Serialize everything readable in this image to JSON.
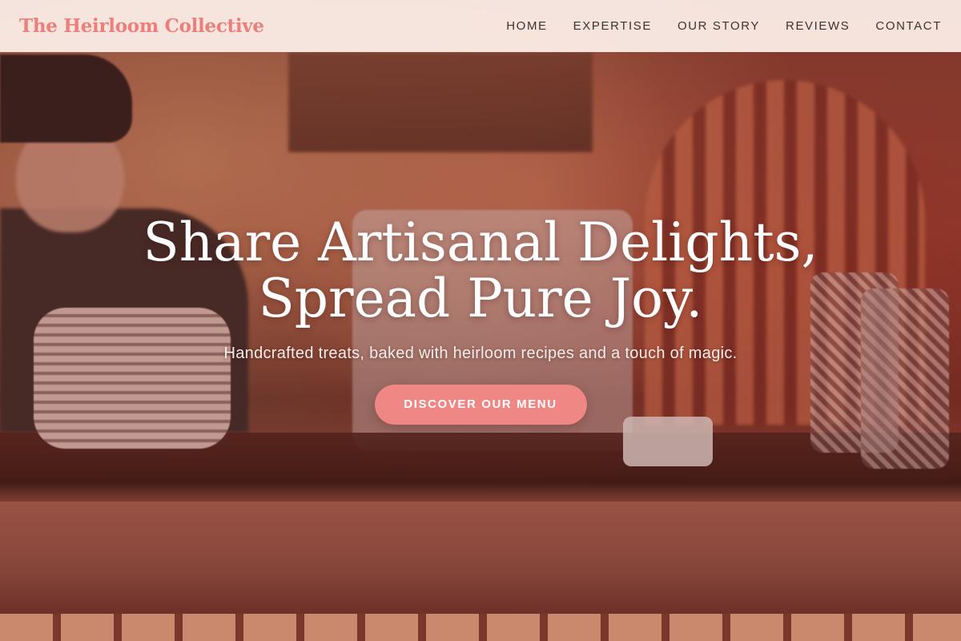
{
  "header": {
    "brand": "The Heirloom Collective",
    "nav": [
      "HOME",
      "EXPERTISE",
      "OUR STORY",
      "REVIEWS",
      "CONTACT"
    ]
  },
  "hero": {
    "title_line1": "Share Artisanal Delights,",
    "title_line2": "Spread Pure Joy.",
    "subtitle": "Handcrafted treats, baked with heirloom recipes and a touch of magic.",
    "cta": "DISCOVER OUR MENU"
  },
  "colors": {
    "accent": "#ef8784",
    "brand": "#ec7f7c",
    "header_bg": "#fceee8",
    "nav_text": "#3b3332",
    "hero_text": "#ffffff"
  }
}
